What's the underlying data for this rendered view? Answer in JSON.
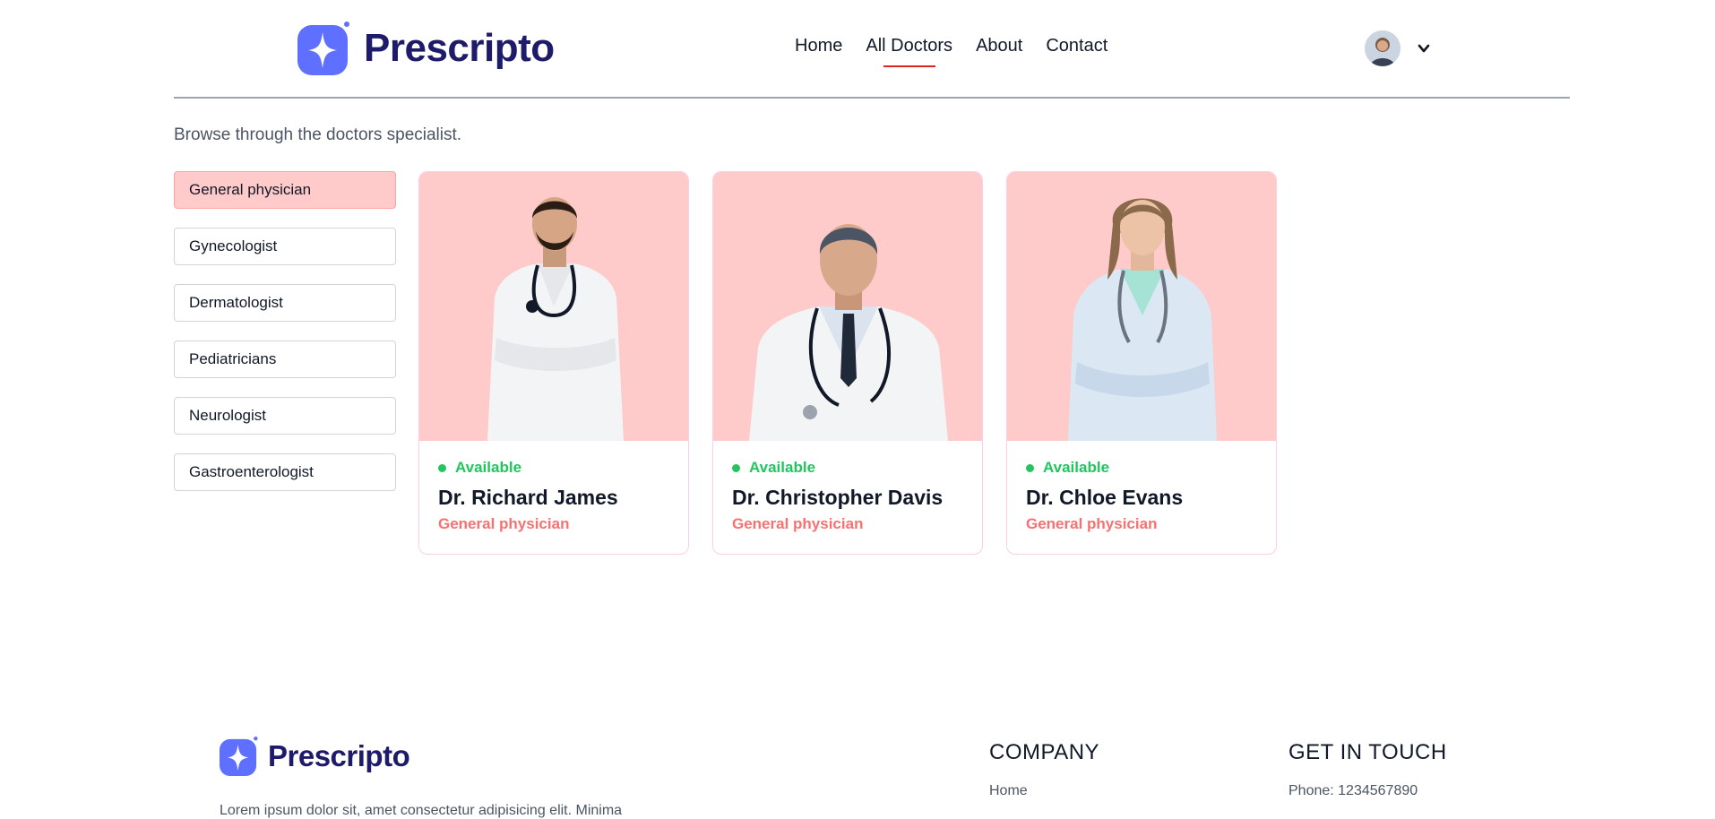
{
  "brand": {
    "name": "Prescripto",
    "color": "#1e1b6b",
    "icon_color": "#5f6fff"
  },
  "nav": {
    "links": [
      {
        "label": "Home",
        "active": false
      },
      {
        "label": "All Doctors",
        "active": true
      },
      {
        "label": "About",
        "active": false
      },
      {
        "label": "Contact",
        "active": false
      }
    ],
    "profile_icon": "user-avatar",
    "dropdown_icon": "chevron-down-icon"
  },
  "main": {
    "intro": "Browse through the doctors specialist.",
    "filters": [
      {
        "label": "General physician",
        "active": true
      },
      {
        "label": "Gynecologist",
        "active": false
      },
      {
        "label": "Dermatologist",
        "active": false
      },
      {
        "label": "Pediatricians",
        "active": false
      },
      {
        "label": "Neurologist",
        "active": false
      },
      {
        "label": "Gastroenterologist",
        "active": false
      }
    ],
    "doctors": [
      {
        "status": "Available",
        "name": "Dr. Richard James",
        "speciality": "General physician"
      },
      {
        "status": "Available",
        "name": "Dr. Christopher Davis",
        "speciality": "General physician"
      },
      {
        "status": "Available",
        "name": "Dr. Chloe Evans",
        "speciality": "General physician"
      }
    ]
  },
  "footer": {
    "brand": "Prescripto",
    "description": "Lorem ipsum dolor sit, amet consectetur adipisicing elit. Minima",
    "company": {
      "title": "COMPANY",
      "items": [
        "Home"
      ]
    },
    "contact": {
      "title": "GET IN TOUCH",
      "items": [
        "Phone: 1234567890"
      ]
    }
  },
  "colors": {
    "accent_red": "#dc2626",
    "card_bg": "#fecaca",
    "available": "#22c55e",
    "speciality": "#f87171"
  }
}
